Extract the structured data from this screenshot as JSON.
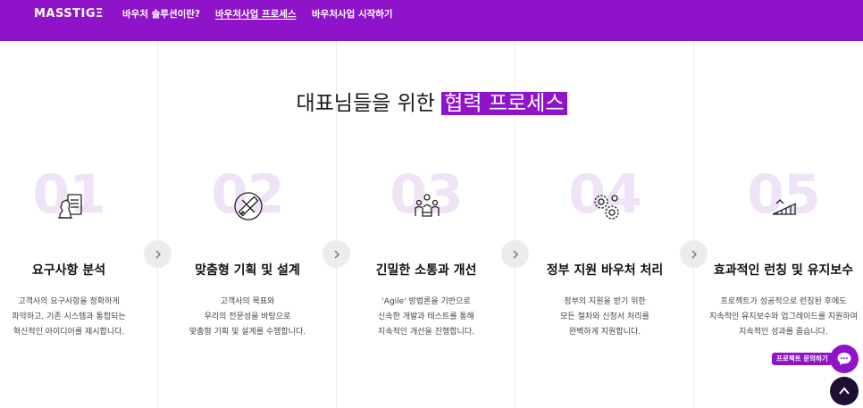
{
  "nav": {
    "logo": "MASSTIGΞ",
    "links": [
      {
        "label": "바우처 솔루션이란?"
      },
      {
        "label": "바우처사업 프로세스"
      },
      {
        "label": "바우처사업 시작하기"
      }
    ]
  },
  "heading": {
    "prefix": "대표님들을 위한",
    "highlight": "협력 프로세스"
  },
  "steps": [
    {
      "number": "01",
      "icon": "chess-knight-document-icon",
      "title": "요구사항 분석",
      "desc": [
        "고객사의 요구사항을 정확하게",
        "파악하고, 기존 시스템과 통합되는",
        "혁신적인 아이디어를 제시합니다."
      ]
    },
    {
      "number": "02",
      "icon": "ruler-pencil-icon",
      "title": "맞춤형 기획 및 설계",
      "desc": [
        "고객사의 목표와",
        "우리의 전문성을 바탕으로",
        "맞춤형 기획 및 설계를 수행합니다."
      ]
    },
    {
      "number": "03",
      "icon": "team-meeting-icon",
      "title": "긴밀한 소통과 개선",
      "desc": [
        "'Agile' 방법론을 기반으로",
        "신속한 개발과 테스트를 통해",
        "지속적인 개선을 진행합니다."
      ]
    },
    {
      "number": "04",
      "icon": "gears-icon",
      "title": "정부 지원 바우처 처리",
      "desc": [
        "정부의 지원을 받기 위한",
        "모든 절차와 신청서 처리를",
        "완벽하게 지원합니다."
      ]
    },
    {
      "number": "05",
      "icon": "launch-ramp-icon",
      "title": "효과적인 런칭 및 유지보수",
      "desc": [
        "프로젝트가 성공적으로 런칭된 후에도",
        "지속적인 유지보수와 업그레이드를 지원하여",
        "지속적인 성과를 줍습니다."
      ]
    }
  ],
  "floating": {
    "chat_label": "프로젝트 문의하기"
  }
}
